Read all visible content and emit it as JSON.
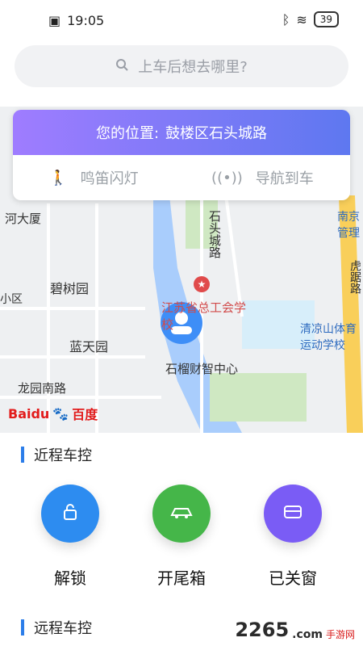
{
  "status": {
    "time": "19:05",
    "battery": "39"
  },
  "search": {
    "placeholder": "上车后想去哪里?"
  },
  "location": {
    "label": "您的位置:",
    "value": "鼓楼区石头城路"
  },
  "quick_actions": [
    {
      "label": "鸣笛闪灯",
      "icon": "walk-icon"
    },
    {
      "label": "导航到车",
      "icon": "signal-icon"
    }
  ],
  "map": {
    "labels": [
      "河大厦",
      "碧树园",
      "蓝天园",
      "龙园南路",
      "石头城路",
      "江苏省总工会学校",
      "石榴财智中心",
      "清凉山体育运动学校",
      "南京管理",
      "虎踞路",
      "小区",
      "Baidu",
      "百度"
    ]
  },
  "sections": {
    "near_control": "近程车控",
    "remote_control": "远程车控"
  },
  "controls": [
    {
      "label": "解锁",
      "color": "#2d8cf0",
      "icon": "unlock-icon"
    },
    {
      "label": "开尾箱",
      "color": "#45b649",
      "icon": "trunk-icon"
    },
    {
      "label": "已关窗",
      "color": "#7a5cf5",
      "icon": "window-icon"
    }
  ],
  "watermark": {
    "main": "2265",
    "sub": "手游网",
    "domain": ".com"
  }
}
